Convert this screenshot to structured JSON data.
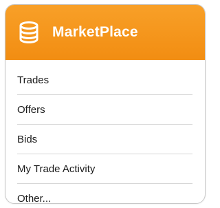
{
  "panel": {
    "title": "MarketPlace",
    "icon": "database-icon",
    "accent_color": "#f28d12"
  },
  "menu": {
    "items": [
      {
        "label": "Trades"
      },
      {
        "label": "Offers"
      },
      {
        "label": "Bids"
      },
      {
        "label": "My Trade Activity"
      },
      {
        "label": "Other..."
      }
    ]
  }
}
